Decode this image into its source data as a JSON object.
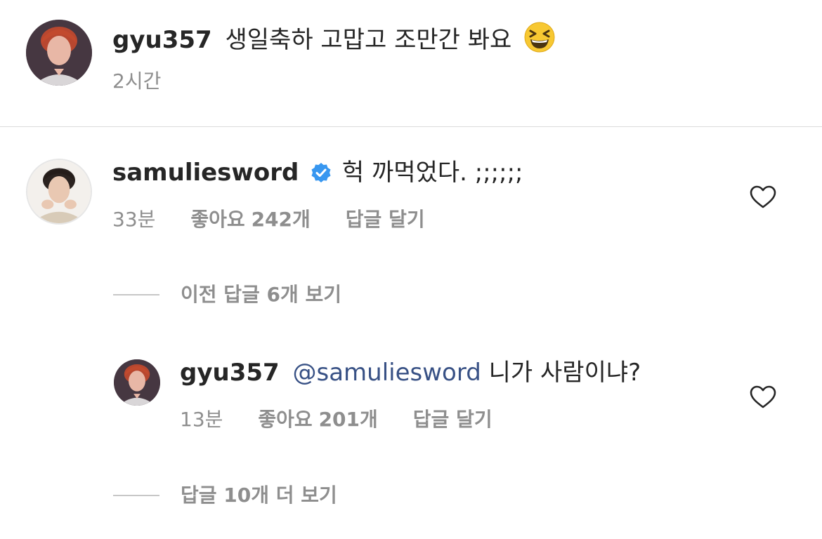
{
  "post_caption": {
    "username": "gyu357",
    "text": "생일축하 고맙고 조만간 봐요",
    "emoji_icon": "grinning-squinting-face-icon",
    "time": "2시간"
  },
  "comment": {
    "username": "samuliesword",
    "verified_icon": "verified-badge-icon",
    "text": "헉 까먹었다. ;;;;;;",
    "time": "33분",
    "likes_label": "좋아요",
    "likes_count": "242개",
    "reply_label": "답글 달기",
    "heart_icon": "heart-outline-icon"
  },
  "view_previous_replies": "이전 답글 6개 보기",
  "reply": {
    "username": "gyu357",
    "mention": "@samuliesword",
    "text": "니가 사람이냐?",
    "time": "13분",
    "likes_label": "좋아요",
    "likes_count": "201개",
    "reply_label": "답글 달기",
    "heart_icon": "heart-outline-icon"
  },
  "view_more_replies": "답글 10개 더 보기",
  "colors": {
    "text_primary": "#262626",
    "text_secondary": "#8e8e8e",
    "mention": "#385185",
    "verified": "#3897f0",
    "divider": "#dbdbdb"
  }
}
